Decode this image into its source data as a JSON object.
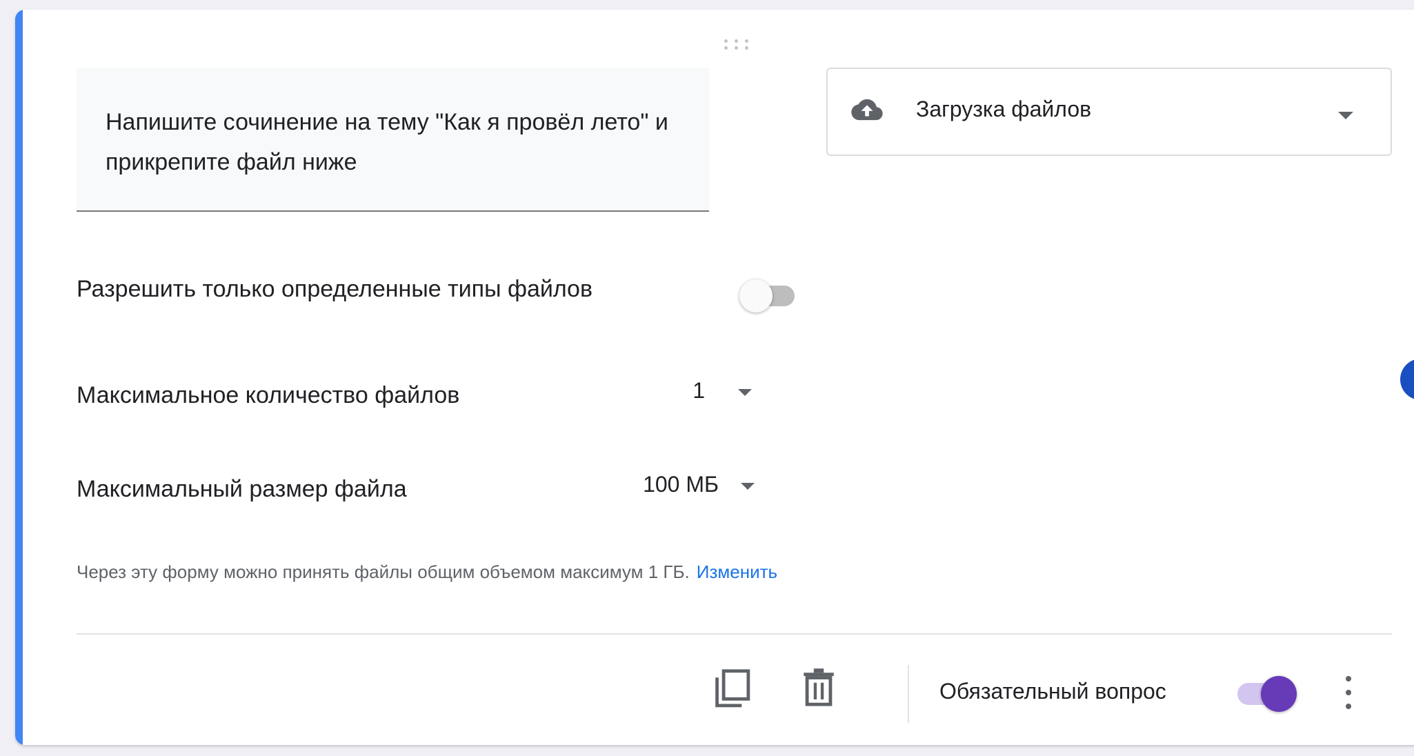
{
  "question": {
    "title": "Напишите сочинение на тему \"Как я провёл лето\" и прикрепите файл ниже"
  },
  "question_type": {
    "icon": "cloud-upload-icon",
    "label": "Загрузка файлов"
  },
  "settings": {
    "allow_types_label": "Разрешить только определенные типы файлов",
    "allow_types_enabled": false,
    "max_files_label": "Максимальное количество файлов",
    "max_files_value": "1",
    "max_size_label": "Максимальный размер файла",
    "max_size_value": "100 МБ",
    "note_text": "Через эту форму можно принять файлы общим объемом максимум 1 ГБ.",
    "note_link": "Изменить"
  },
  "footer": {
    "required_label": "Обязательный вопрос",
    "required_enabled": true,
    "icons": [
      "copy-icon",
      "trash-icon",
      "more-vert-icon"
    ]
  },
  "colors": {
    "accent": "#4285f4",
    "toggle_on": "#673ab7",
    "link": "#1a73e8"
  }
}
